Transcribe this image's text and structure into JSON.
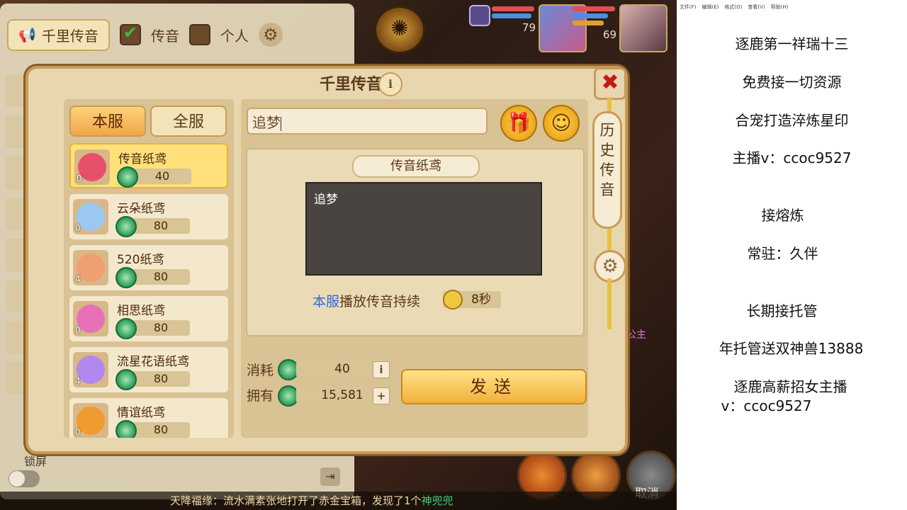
{
  "background": {
    "channel_tab": "千里传音",
    "checkbox_voice": "传音",
    "checkbox_personal": "个人",
    "lock_label": "锁屏",
    "ticker": {
      "prefix": "天降福缘：",
      "player": "流水满素张地打开了赤金宝箱，发现了1个",
      "item": "神兜兜"
    },
    "level_left": "79",
    "level_right": "69",
    "cancel_label": "取消",
    "side_text": "公主"
  },
  "dialog": {
    "title": "千里传音",
    "close_icon": "close-icon",
    "server_tabs": [
      "本服",
      "全服"
    ],
    "items": [
      {
        "name": "传音纸鸢",
        "count": "0",
        "price": "40",
        "color": "#e8506a",
        "selected": true
      },
      {
        "name": "云朵纸鸢",
        "count": "0",
        "price": "80",
        "color": "#9ac8f0",
        "selected": false
      },
      {
        "name": "520纸鸢",
        "count": "4",
        "price": "80",
        "color": "#f0a070",
        "selected": false
      },
      {
        "name": "相思纸鸢",
        "count": "0",
        "price": "80",
        "color": "#e870b8",
        "selected": false
      },
      {
        "name": "流星花语纸鸢",
        "count": "4",
        "price": "80",
        "color": "#b088f0",
        "selected": false
      },
      {
        "name": "情谊纸鸢",
        "count": "0",
        "price": "80",
        "color": "#f09a30",
        "selected": false
      }
    ],
    "input_value": "追梦",
    "preview_label": "传音纸鸢",
    "preview_text": "追梦",
    "duration_scope": "本服",
    "duration_text": "播放传音持续",
    "duration_value": "8秒",
    "cost_label": "消耗",
    "cost_value": "40",
    "own_label": "拥有",
    "own_value": "15,581",
    "send_label": "发送",
    "history_tab": "历史传音"
  },
  "stream_panel": {
    "menu": [
      "文件(F)",
      "编辑(E)",
      "格式(O)",
      "查看(V)",
      "帮助(H)"
    ],
    "lines": [
      "逐鹿第一祥瑞十三",
      "免费接一切资源",
      "合宠打造淬炼星印",
      "主播v：ccoc9527",
      "接熔炼",
      "常驻：久伴",
      "长期接托管",
      "年托管送双神兽13888",
      "逐鹿高薪招女主播",
      "v：ccoc9527"
    ]
  }
}
